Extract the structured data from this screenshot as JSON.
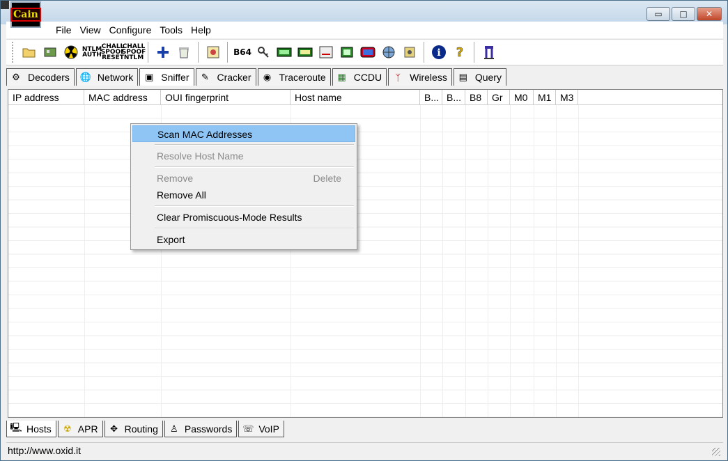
{
  "app": {
    "logo_text": "Cain"
  },
  "window_controls": {
    "minimize": "▭",
    "maximize": "□",
    "close": "✕"
  },
  "menu": [
    "File",
    "View",
    "Configure",
    "Tools",
    "Help"
  ],
  "toolbar_icons": [
    "open-folder-icon",
    "network-card-icon",
    "radiation-icon",
    "ntlm-auth-icon",
    "chall-spoof-reset-icon",
    "chall-spoof-ntlm-icon",
    "add-icon",
    "recycle-bin-icon",
    "certificate-icon",
    "base64-icon",
    "key-icon",
    "vpn-icon",
    "vpn2-icon",
    "rsa-icon",
    "chip-icon",
    "display-icon",
    "globe-icon",
    "lock-icon",
    "info-icon",
    "help-icon",
    "usb-icon"
  ],
  "toolbar_labels": {
    "ntlm": "NTLM AUTH",
    "chall1": "CHALL SPOOF RESET",
    "chall2": "CHALL SPOOF NTLM",
    "b64": "B64"
  },
  "top_tabs": [
    {
      "label": "Decoders",
      "icon": "decoder-icon"
    },
    {
      "label": "Network",
      "icon": "globe-icon"
    },
    {
      "label": "Sniffer",
      "icon": "sniffer-icon"
    },
    {
      "label": "Cracker",
      "icon": "cracker-icon"
    },
    {
      "label": "Traceroute",
      "icon": "traceroute-icon"
    },
    {
      "label": "CCDU",
      "icon": "ccdu-icon"
    },
    {
      "label": "Wireless",
      "icon": "antenna-icon"
    },
    {
      "label": "Query",
      "icon": "query-icon"
    }
  ],
  "columns": [
    "IP address",
    "MAC address",
    "OUI fingerprint",
    "Host name",
    "B...",
    "B...",
    "B8",
    "Gr",
    "M0",
    "M1",
    "M3"
  ],
  "context_menu": {
    "scan": "Scan MAC Addresses",
    "resolve": "Resolve Host Name",
    "remove": "Remove",
    "remove_shortcut": "Delete",
    "remove_all": "Remove All",
    "clear": "Clear Promiscuous-Mode Results",
    "export": "Export"
  },
  "bottom_tabs": [
    {
      "label": "Hosts",
      "icon": "computer-icon"
    },
    {
      "label": "APR",
      "icon": "radiation-icon"
    },
    {
      "label": "Routing",
      "icon": "routing-icon"
    },
    {
      "label": "Passwords",
      "icon": "user-icon"
    },
    {
      "label": "VoIP",
      "icon": "voip-icon"
    }
  ],
  "status": {
    "text": "http://www.oxid.it"
  }
}
